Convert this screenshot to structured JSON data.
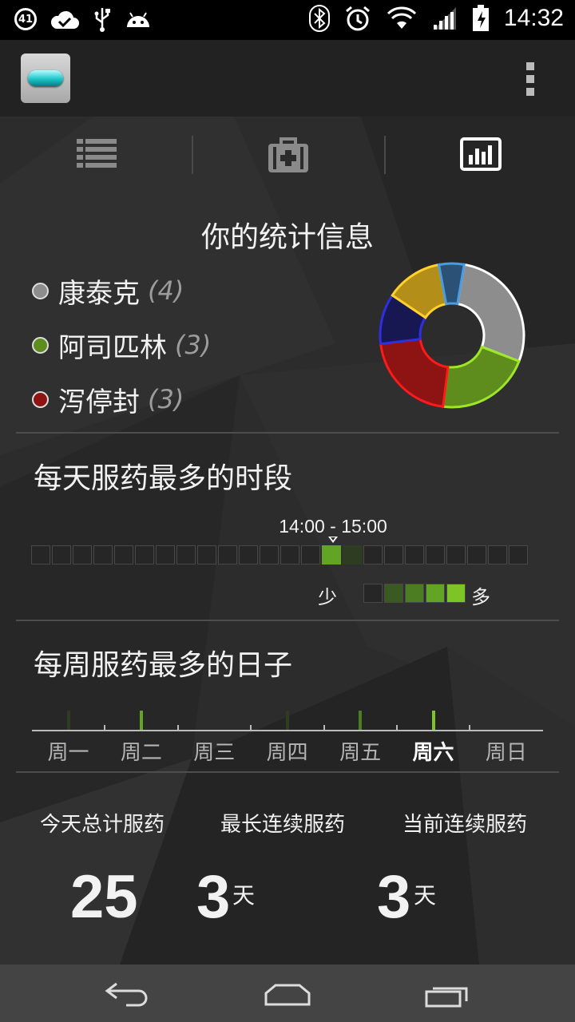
{
  "status_bar": {
    "notification_count": "41",
    "time": "14:32"
  },
  "tabs": [
    {
      "name": "list-tab",
      "icon": "list-icon",
      "selected": false
    },
    {
      "name": "medicine-kit-tab",
      "icon": "first-aid-kit-icon",
      "selected": false
    },
    {
      "name": "statistics-tab",
      "icon": "bar-chart-icon",
      "selected": true
    }
  ],
  "stats": {
    "title": "你的统计信息",
    "legend": [
      {
        "name": "康泰克",
        "count": "(4)",
        "color": "#8d8d8d"
      },
      {
        "name": "阿司匹林",
        "count": "(3)",
        "color": "#5e8d1e"
      },
      {
        "name": "泻停封",
        "count": "(3)",
        "color": "#8e1414"
      }
    ]
  },
  "chart_data": {
    "type": "pie",
    "donut": true,
    "slices": [
      {
        "value": 4,
        "color": "#8d8d8d",
        "stroke": "#ffffff"
      },
      {
        "value": 3,
        "color": "#5e8d1e",
        "stroke": "#9ee62a"
      },
      {
        "value": 3,
        "color": "#8e1414",
        "stroke": "#ff1a1a"
      },
      {
        "value": 1.6,
        "color": "#171752",
        "stroke": "#2f2fe0"
      },
      {
        "value": 1.8,
        "color": "#b38f1a",
        "stroke": "#ffd12a"
      },
      {
        "value": 0.8,
        "color": "#2b5276",
        "stroke": "#4a9be0"
      }
    ]
  },
  "peak_hours": {
    "title": "每天服药最多的时段",
    "highlight_label": "14:00 - 15:00",
    "levels": [
      0,
      0,
      0,
      0,
      0,
      0,
      0,
      0,
      0,
      0,
      0,
      0,
      0,
      0,
      4,
      1,
      0,
      0,
      0,
      0,
      0,
      0,
      0,
      0
    ],
    "less_label": "少",
    "more_label": "多",
    "level_colors": [
      "#262626",
      "#2e3d22",
      "#3b5a22",
      "#4d7d22",
      "#62a423",
      "#7cc524"
    ]
  },
  "peak_days": {
    "title": "每周服药最多的日子",
    "days": [
      {
        "label": "周一",
        "level": 1,
        "active": false
      },
      {
        "label": "周二",
        "level": 4,
        "active": false
      },
      {
        "label": "周三",
        "level": 0,
        "active": false
      },
      {
        "label": "周四",
        "level": 1,
        "active": false
      },
      {
        "label": "周五",
        "level": 3,
        "active": false
      },
      {
        "label": "周六",
        "level": 5,
        "active": true
      },
      {
        "label": "周日",
        "level": 0,
        "active": false
      }
    ]
  },
  "summary": {
    "today_total_label": "今天总计服药",
    "today_total_value": "25",
    "longest_streak_label": "最长连续服药",
    "longest_streak_value": "3",
    "longest_streak_unit": "天",
    "current_streak_label": "当前连续服药",
    "current_streak_value": "3",
    "current_streak_unit": "天"
  }
}
